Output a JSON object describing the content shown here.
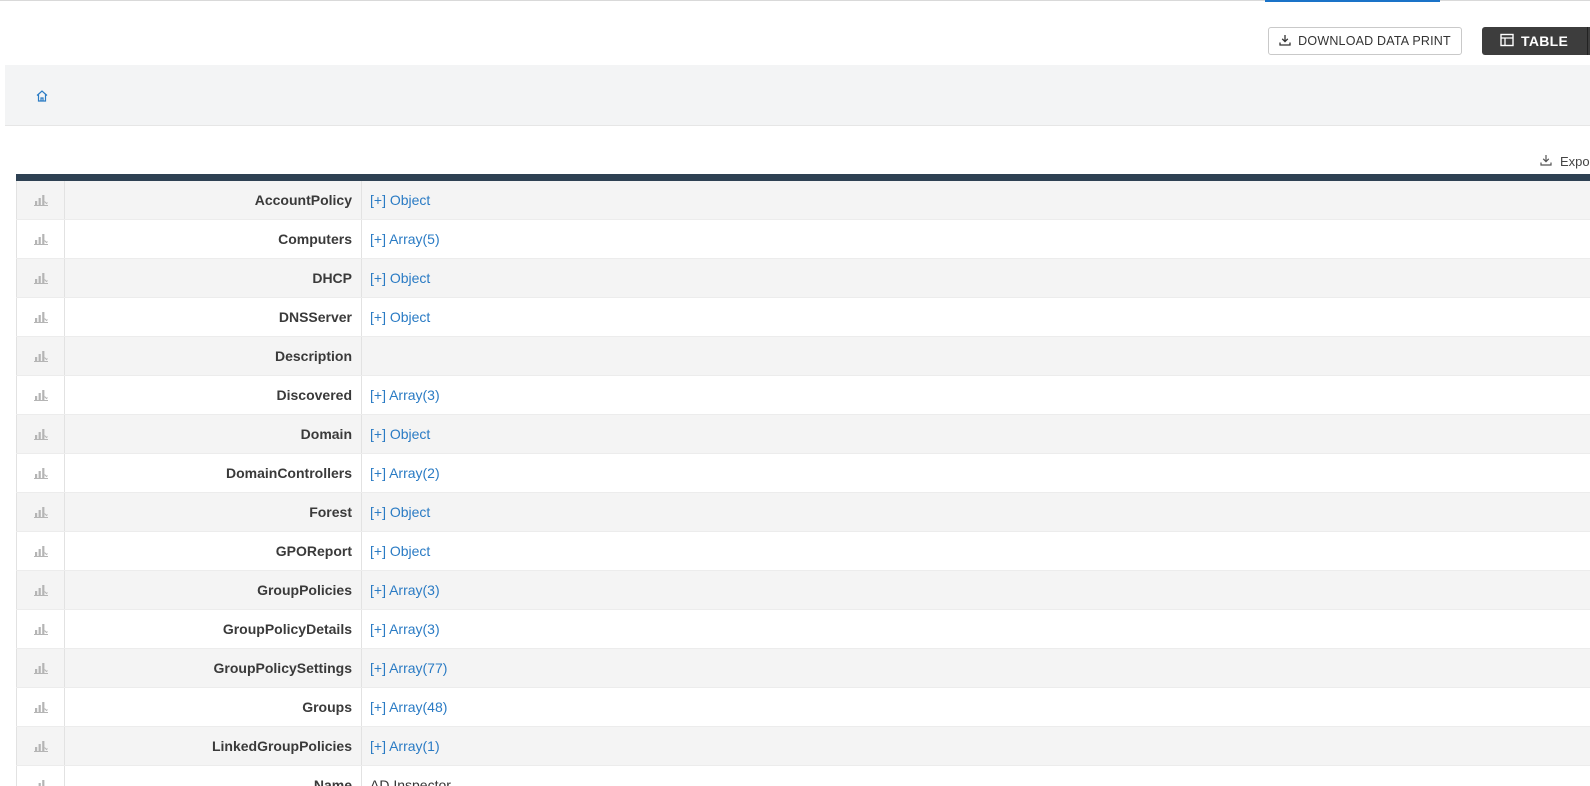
{
  "toolbar": {
    "download_label": "DOWNLOAD DATA PRINT",
    "table_label": "TABLE",
    "export_label": "Export"
  },
  "breadcrumb": {
    "home_icon": "home-icon"
  },
  "rows": [
    {
      "key": "AccountPolicy",
      "value": "[+] Object",
      "link": true
    },
    {
      "key": "Computers",
      "value": "[+] Array(5)",
      "link": true
    },
    {
      "key": "DHCP",
      "value": "[+] Object",
      "link": true
    },
    {
      "key": "DNSServer",
      "value": "[+] Object",
      "link": true
    },
    {
      "key": "Description",
      "value": "",
      "link": false
    },
    {
      "key": "Discovered",
      "value": "[+] Array(3)",
      "link": true
    },
    {
      "key": "Domain",
      "value": "[+] Object",
      "link": true
    },
    {
      "key": "DomainControllers",
      "value": "[+] Array(2)",
      "link": true
    },
    {
      "key": "Forest",
      "value": "[+] Object",
      "link": true
    },
    {
      "key": "GPOReport",
      "value": "[+] Object",
      "link": true
    },
    {
      "key": "GroupPolicies",
      "value": "[+] Array(3)",
      "link": true
    },
    {
      "key": "GroupPolicyDetails",
      "value": "[+] Array(3)",
      "link": true
    },
    {
      "key": "GroupPolicySettings",
      "value": "[+] Array(77)",
      "link": true
    },
    {
      "key": "Groups",
      "value": "[+] Array(48)",
      "link": true
    },
    {
      "key": "LinkedGroupPolicies",
      "value": "[+] Array(1)",
      "link": true
    },
    {
      "key": "Name",
      "value": "AD Inspector",
      "link": false
    }
  ],
  "colors": {
    "link": "#2a7bc4",
    "header_bar": "#2e4153",
    "table_button": "#3d3d3d"
  }
}
